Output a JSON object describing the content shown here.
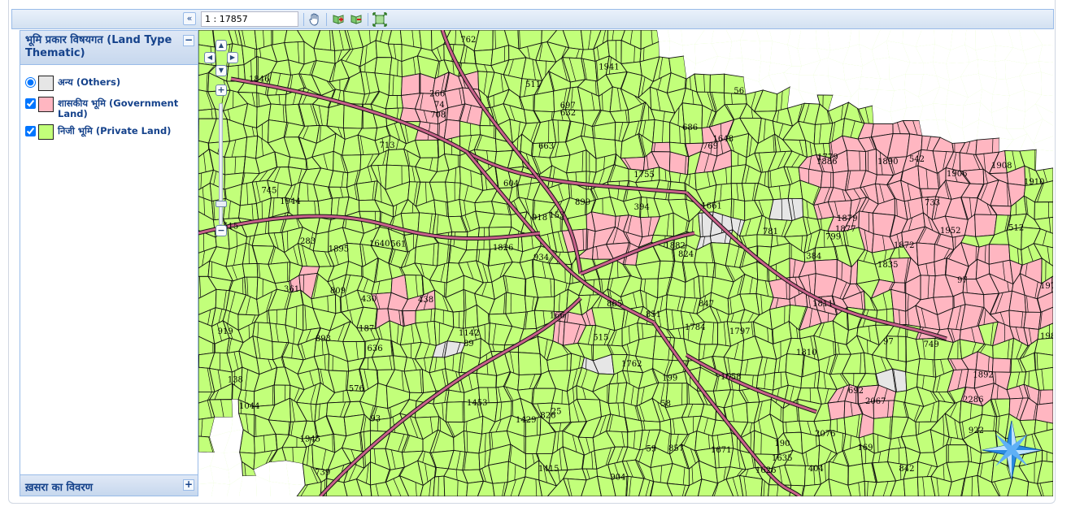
{
  "toolbar": {
    "collapse_icon": "double-chevron-left",
    "scale_value": "1 : 17857",
    "tools": [
      "pan-hand-icon",
      "zoom-in-icon",
      "zoom-out-icon",
      "full-extent-icon"
    ]
  },
  "panel": {
    "title": "भूमि प्रकार विषयगत (Land Type Thematic)",
    "legend": [
      {
        "label": "अन्य (Others)",
        "control": "radio",
        "checked": true,
        "color": "#e6e6e6"
      },
      {
        "label": "शासकीय भूमि (Government Land)",
        "control": "checkbox",
        "checked": true,
        "color": "#ffb6c1"
      },
      {
        "label": "निजी भूमि (Private Land)",
        "control": "checkbox",
        "checked": true,
        "color": "#c2ff7a"
      }
    ],
    "footer": "ख़सरा का विवरण"
  },
  "colors": {
    "private": "#c2ff7a",
    "government": "#ffb6c1",
    "others": "#e6e6e6",
    "boundary": "#111111",
    "road": "#c8618a"
  },
  "map": {
    "parcel_labels": [
      "1906",
      "1890",
      "1886",
      "1952",
      "1879",
      "1872",
      "1811",
      "1810",
      "1658",
      "1671",
      "1626",
      "1635",
      "1648",
      "1640",
      "1661",
      "2067",
      "2286",
      "2076",
      "1975",
      "1982",
      "1908",
      "1910",
      "1892",
      "1895",
      "1945",
      "1941",
      "1944",
      "1835",
      "1846",
      "1877",
      "1882",
      "1826",
      "1797",
      "1784",
      "1779",
      "1762",
      "1755",
      "1415",
      "1429",
      "1453",
      "1142",
      "1044",
      "438",
      "430",
      "361",
      "283",
      "266",
      "199",
      "190",
      "187",
      "169",
      "166",
      "153",
      "138",
      "89",
      "97",
      "74",
      "97",
      "93",
      "511",
      "515",
      "604",
      "632",
      "636",
      "663",
      "686",
      "692",
      "697",
      "708",
      "713",
      "733",
      "739",
      "745",
      "749",
      "762",
      "769",
      "781",
      "799",
      "809",
      "824",
      "826",
      "842",
      "847",
      "851",
      "857",
      "865",
      "893",
      "899",
      "904",
      "918",
      "919",
      "922",
      "934",
      "394",
      "384",
      "404",
      "512",
      "515",
      "542",
      "561",
      "576",
      "56",
      "58",
      "59",
      "25"
    ]
  }
}
